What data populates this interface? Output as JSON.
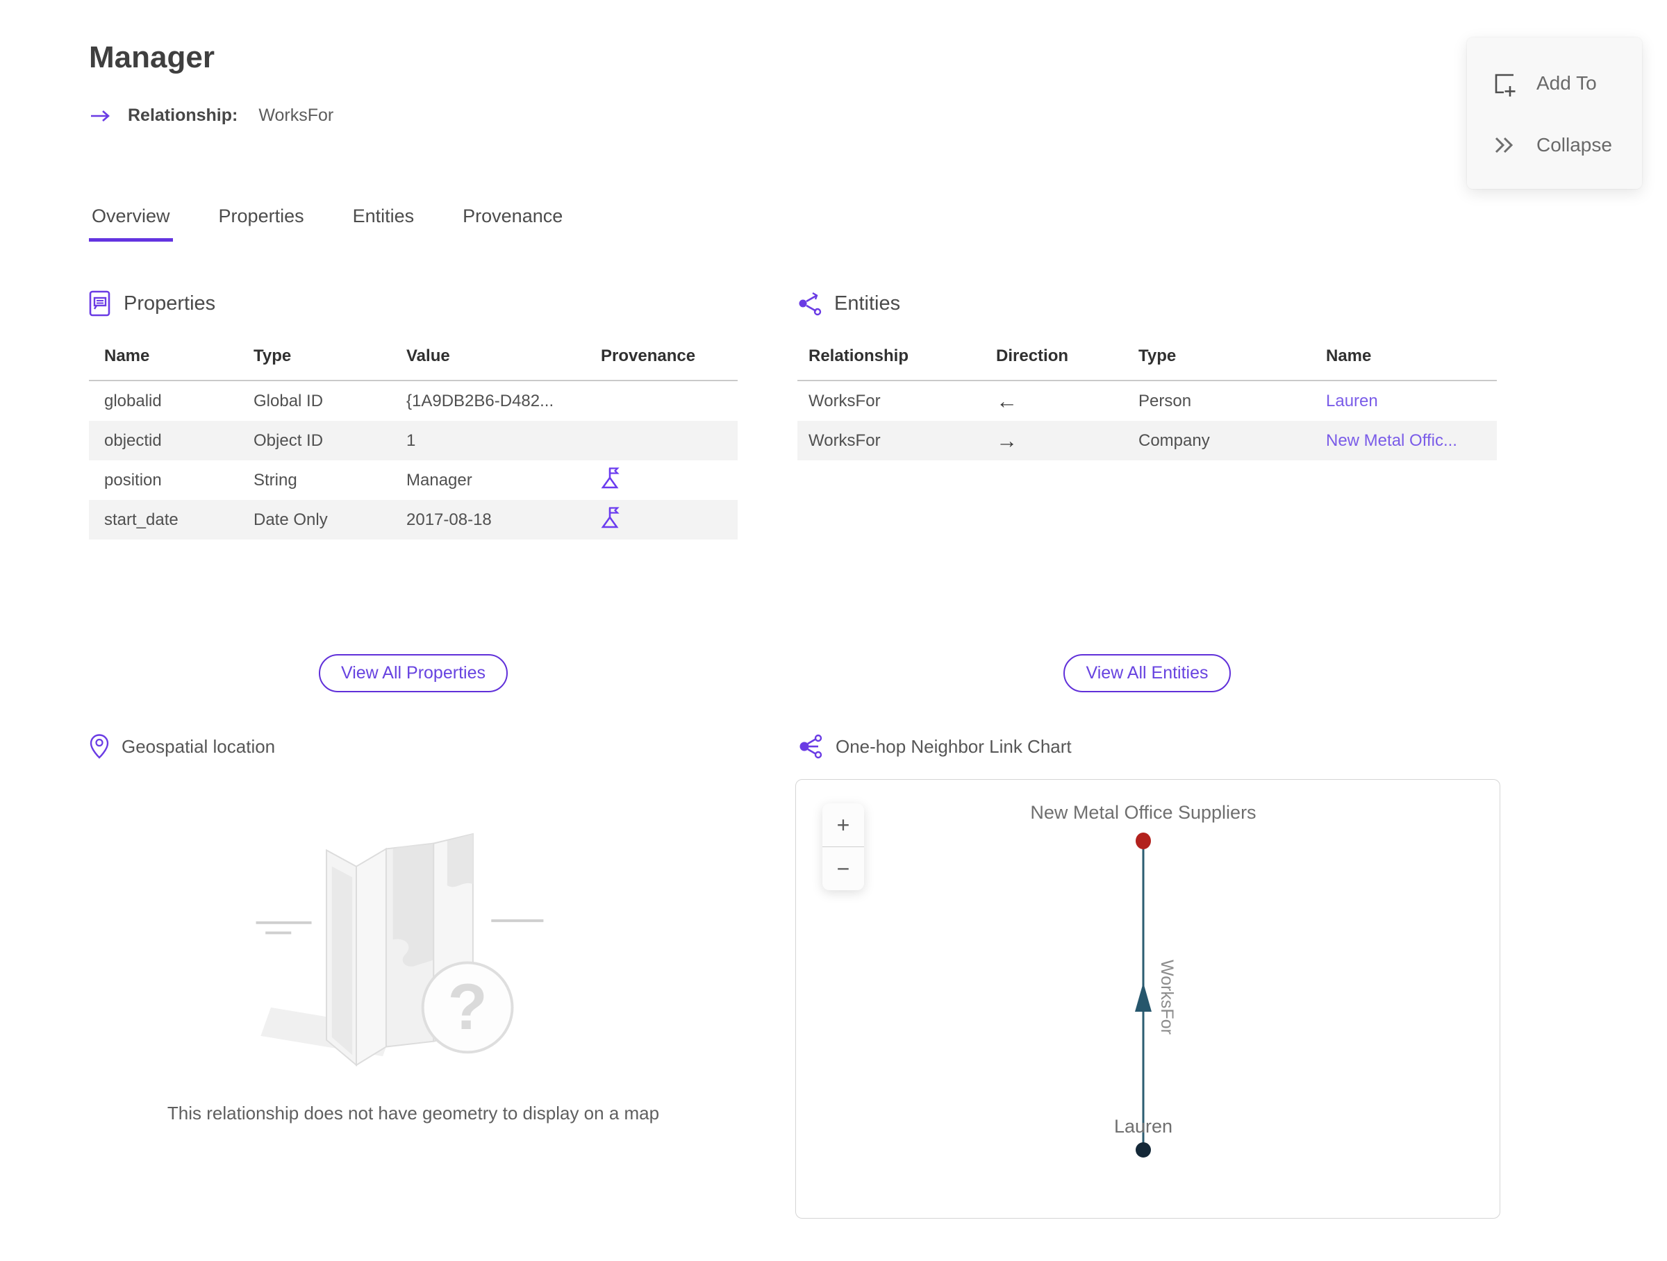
{
  "header": {
    "title": "Manager",
    "subtitle_label": "Relationship:",
    "subtitle_value": "WorksFor"
  },
  "actions": {
    "add_to": "Add To",
    "collapse": "Collapse"
  },
  "tabs": [
    {
      "label": "Overview",
      "active": true
    },
    {
      "label": "Properties",
      "active": false
    },
    {
      "label": "Entities",
      "active": false
    },
    {
      "label": "Provenance",
      "active": false
    }
  ],
  "properties_section": {
    "title": "Properties",
    "columns": [
      "Name",
      "Type",
      "Value",
      "Provenance"
    ],
    "rows": [
      {
        "name": "globalid",
        "type": "Global ID",
        "value": "{1A9DB2B6-D482...",
        "provenance": false
      },
      {
        "name": "objectid",
        "type": "Object ID",
        "value": "1",
        "provenance": false
      },
      {
        "name": "position",
        "type": "String",
        "value": "Manager",
        "provenance": true
      },
      {
        "name": "start_date",
        "type": "Date Only",
        "value": "2017-08-18",
        "provenance": true
      }
    ],
    "view_all_label": "View All Properties"
  },
  "entities_section": {
    "title": "Entities",
    "columns": [
      "Relationship",
      "Direction",
      "Type",
      "Name"
    ],
    "rows": [
      {
        "relationship": "WorksFor",
        "direction": "←",
        "type": "Person",
        "name": "Lauren"
      },
      {
        "relationship": "WorksFor",
        "direction": "→",
        "type": "Company",
        "name": "New Metal Offic..."
      }
    ],
    "view_all_label": "View All Entities"
  },
  "geospatial_section": {
    "title": "Geospatial location",
    "empty_message": "This relationship does not have geometry to display on a map"
  },
  "link_chart_section": {
    "title": "One-hop Neighbor Link Chart",
    "zoom_in": "+",
    "zoom_out": "−",
    "chart_data": {
      "type": "node-link",
      "nodes": [
        {
          "label": "New Metal Office Suppliers",
          "entity_type": "Company",
          "color": "#b2211d",
          "position": "top"
        },
        {
          "label": "Lauren",
          "entity_type": "Person",
          "color": "#142838",
          "position": "bottom"
        }
      ],
      "edges": [
        {
          "from": "Lauren",
          "to": "New Metal Office Suppliers",
          "label": "WorksFor",
          "color": "#2c5d72",
          "direction": "up"
        }
      ]
    }
  },
  "colors": {
    "accent_purple": "#6334e0",
    "link_purple": "#7a5ce8",
    "edge_teal": "#2c5d72",
    "node_red": "#b2211d",
    "node_navy": "#142838",
    "row_alt_gray": "#f3f3f3"
  }
}
